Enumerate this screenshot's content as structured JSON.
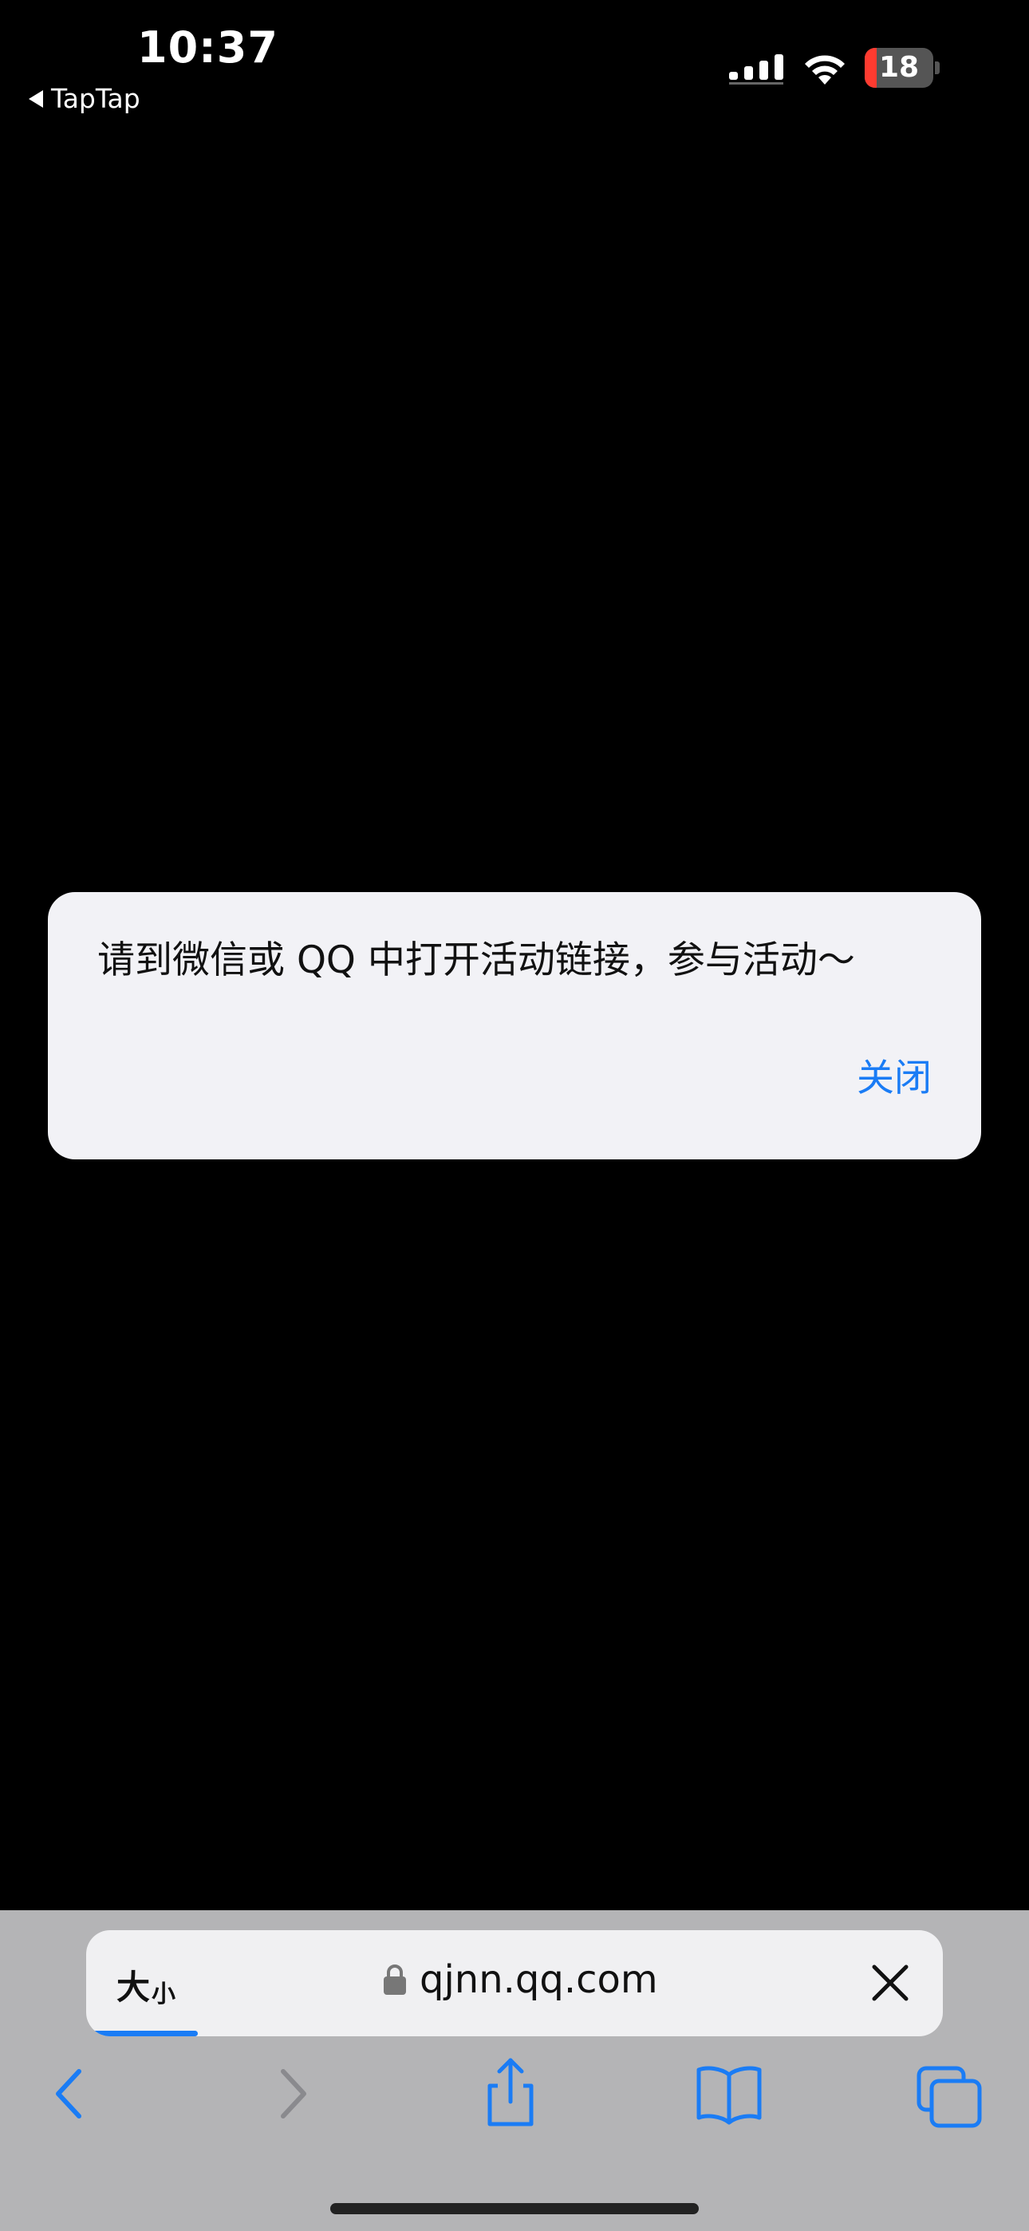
{
  "status_bar": {
    "time": "10:37",
    "back_app": "TapTap",
    "battery_level": "18",
    "battery_fraction": 0.18
  },
  "alert": {
    "message": "请到微信或 QQ 中打开活动链接，参与活动～",
    "close_label": "关闭"
  },
  "browser": {
    "text_size_big": "大",
    "text_size_small": "小",
    "url": "qjnn.qq.com",
    "load_progress": 0.13
  },
  "colors": {
    "accent": "#1a7cf5",
    "battery_low": "#ff3b30",
    "alert_bg": "#f2f2f6",
    "toolbar_bg": "#b4b4b6"
  },
  "icons": {
    "back": "chevron-left-icon",
    "forward": "chevron-right-icon",
    "share": "share-icon",
    "bookmarks": "book-icon",
    "tabs": "tabs-icon",
    "stop": "close-icon",
    "lock": "lock-icon"
  }
}
